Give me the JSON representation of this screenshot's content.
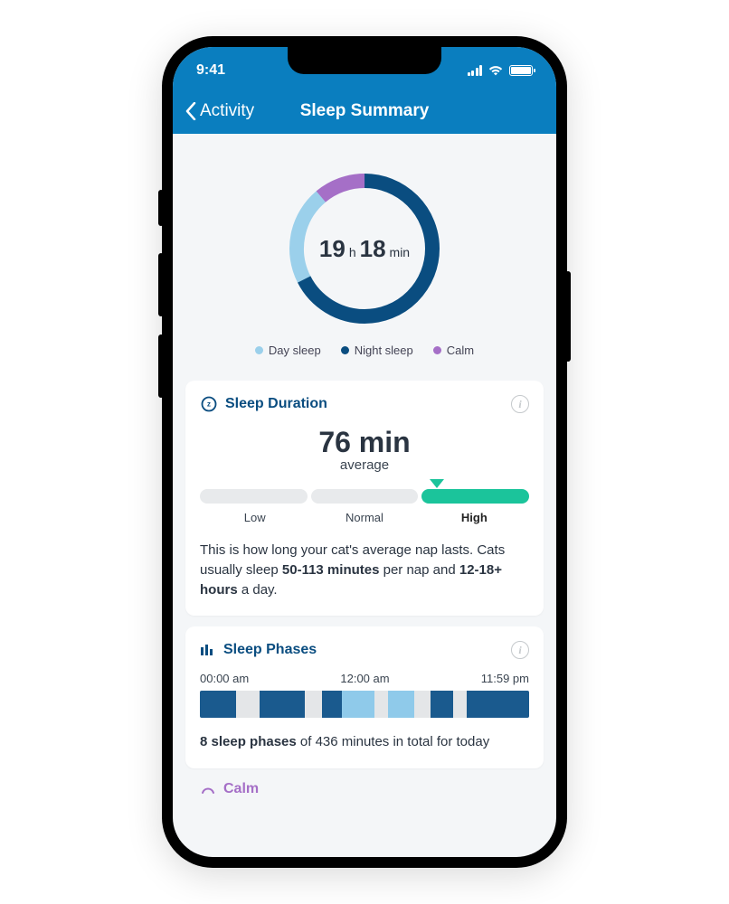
{
  "status": {
    "time": "9:41"
  },
  "nav": {
    "back_label": "Activity",
    "title": "Sleep Summary"
  },
  "ring": {
    "hours": "19",
    "h_unit": "h",
    "minutes": "18",
    "m_unit": "min",
    "arcs": {
      "night_deg": 243,
      "day_deg": 77,
      "calm_deg": 40
    }
  },
  "legend": {
    "day": "Day sleep",
    "night": "Night sleep",
    "calm": "Calm"
  },
  "duration_card": {
    "title": "Sleep Duration",
    "value": "76 min",
    "avg_label": "average",
    "labels": {
      "low": "Low",
      "normal": "Normal",
      "high": "High"
    },
    "pointer_pct": 72,
    "desc_1": "This is how long your cat's average nap lasts. Cats usually sleep ",
    "desc_bold_1": "50-113 minutes",
    "desc_2": " per nap and ",
    "desc_bold_2": "12-18+ hours",
    "desc_3": " a day."
  },
  "phases_card": {
    "title": "Sleep Phases",
    "t0": "00:00 am",
    "t1": "12:00 am",
    "t2": "11:59 pm",
    "summary_bold": "8 sleep phases",
    "summary_rest": " of 436 minutes in total for today",
    "segments": [
      {
        "c": "dark",
        "w": 11
      },
      {
        "c": "gap",
        "w": 7
      },
      {
        "c": "dark",
        "w": 14
      },
      {
        "c": "gap",
        "w": 5
      },
      {
        "c": "dark",
        "w": 6
      },
      {
        "c": "light",
        "w": 10
      },
      {
        "c": "gap",
        "w": 4
      },
      {
        "c": "light",
        "w": 8
      },
      {
        "c": "gap",
        "w": 5
      },
      {
        "c": "dark",
        "w": 7
      },
      {
        "c": "gap",
        "w": 4
      },
      {
        "c": "dark",
        "w": 19
      }
    ]
  },
  "calm_card": {
    "title": "Calm"
  },
  "chart_data": {
    "type": "pie",
    "title": "Sleep Summary total time breakdown",
    "series": [
      {
        "name": "Night sleep",
        "value_deg": 243,
        "color": "#0a4d80"
      },
      {
        "name": "Day sleep",
        "value_deg": 77,
        "color": "#9bd0eb"
      },
      {
        "name": "Calm",
        "value_deg": 40,
        "color": "#a56fc7"
      }
    ],
    "center_label": "19 h 18 min"
  }
}
